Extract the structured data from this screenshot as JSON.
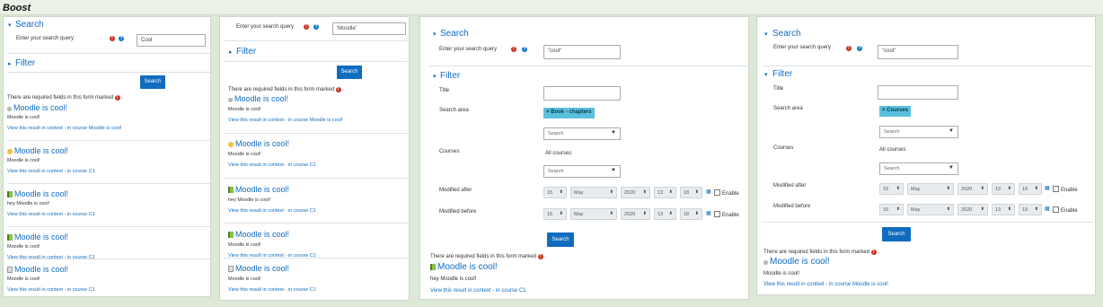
{
  "header": {
    "label": "Boost"
  },
  "common": {
    "search_title": "Search",
    "filter_title": "Filter",
    "query_label": "Enter your search query",
    "search_button": "Search",
    "required_note": "There are required fields in this form marked",
    "dot": ".",
    "title_label": "Title",
    "search_area_label": "Search area",
    "courses_label": "Courses",
    "all_courses": "All courses",
    "search_placeholder": "Search",
    "modified_after": "Modified after",
    "modified_before": "Modified before",
    "enable": "Enable",
    "context_prefix": "View this result in context",
    "in_course": " - in course "
  },
  "icons": {
    "required": "exclamation-icon",
    "help": "question-icon",
    "calendar": "calendar-icon"
  },
  "colors": {
    "accent": "#0f6cbf",
    "required": "#ca3120",
    "tag": "#5bc0de"
  },
  "panel1": {
    "query_value": "Cool",
    "results": [
      {
        "icon": "forum-icon",
        "title": "Moodle is cool!",
        "text": "Moodle is cool!",
        "course": "Moodle is cool!"
      },
      {
        "icon": "glossary-icon",
        "title": "Moodle is cool!",
        "text": "Moodle is cool!",
        "course": "C1"
      },
      {
        "icon": "book-icon",
        "title": "Moodle is cool!",
        "text": "hey Moodle is cool!",
        "course": "C1"
      },
      {
        "icon": "book-icon",
        "title": "Moodle is cool!",
        "text": "Moodle is cool!",
        "course": "C1"
      },
      {
        "icon": "page-icon",
        "title": "Moodle is cool!",
        "text": "Moodle is cool!",
        "course": "C1"
      }
    ]
  },
  "panel2": {
    "query_value": "'Moodle'",
    "results": [
      {
        "icon": "forum-icon",
        "title": "Moodle is cool!",
        "text": "Moodle is cool!",
        "course": "Moodle is cool!"
      },
      {
        "icon": "glossary-icon",
        "title": "Moodle is cool!",
        "text": "Moodle is cool!",
        "course": "C1"
      },
      {
        "icon": "book-icon",
        "title": "Moodle is cool!",
        "text": "hey Moodle is cool!",
        "course": "C1"
      },
      {
        "icon": "book-icon",
        "title": "Moodle is cool!",
        "text": "Moodle is cool!",
        "course": "C1"
      },
      {
        "icon": "page-icon",
        "title": "Moodle is cool!",
        "text": "Moodle is cool!",
        "course": "C1"
      }
    ]
  },
  "panel3": {
    "query_value": "\"cool\"",
    "area_tag": "× Book - chapters",
    "after": {
      "day": "15",
      "month": "May",
      "year": "2020",
      "hour": "13",
      "minute": "18"
    },
    "before": {
      "day": "15",
      "month": "May",
      "year": "2020",
      "hour": "13",
      "minute": "18"
    },
    "result": {
      "icon": "book-icon",
      "title": "Moodle is cool!",
      "text": "hey Moodle is cool!",
      "course": "C1"
    }
  },
  "panel4": {
    "query_value": "\"cool\"",
    "area_tag": "× Courses",
    "after": {
      "day": "15",
      "month": "May",
      "year": "2020",
      "hour": "13",
      "minute": "19"
    },
    "before": {
      "day": "15",
      "month": "May",
      "year": "2020",
      "hour": "13",
      "minute": "19"
    },
    "result": {
      "icon": "forum-icon",
      "title": "Moodle is cool!",
      "text": "Moodle is cool!",
      "course": "Moodle is cool!"
    }
  }
}
